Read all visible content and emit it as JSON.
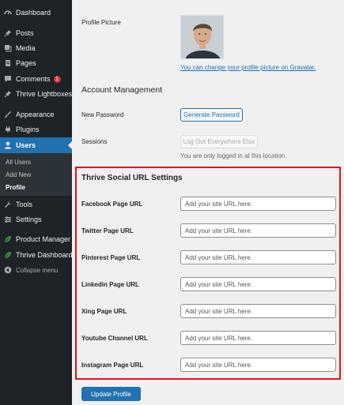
{
  "sidebar": {
    "items": [
      {
        "label": "Dashboard",
        "icon": "dashboard-icon"
      },
      {
        "label": "Posts",
        "icon": "pin-icon"
      },
      {
        "label": "Media",
        "icon": "media-icon"
      },
      {
        "label": "Pages",
        "icon": "page-icon"
      },
      {
        "label": "Comments",
        "icon": "comment-icon",
        "badge": "1"
      },
      {
        "label": "Thrive Lightboxes",
        "icon": "pin-icon"
      },
      {
        "label": "Appearance",
        "icon": "brush-icon"
      },
      {
        "label": "Plugins",
        "icon": "plugin-icon"
      },
      {
        "label": "Users",
        "icon": "user-icon"
      },
      {
        "label": "Tools",
        "icon": "wrench-icon"
      },
      {
        "label": "Settings",
        "icon": "settings-icon"
      },
      {
        "label": "Product Manager",
        "icon": "leaf-icon"
      },
      {
        "label": "Thrive Dashboard",
        "icon": "leaf-icon"
      },
      {
        "label": "Collapse menu",
        "icon": "collapse-icon"
      }
    ],
    "users_submenu": [
      "All Users",
      "Add New",
      "Profile"
    ]
  },
  "profile": {
    "picture_label": "Profile Picture",
    "gravatar_link": "You can change your profile picture on Gravatar",
    "gravatar_suffix": "."
  },
  "account": {
    "title": "Account Management",
    "new_password_label": "New Password",
    "generate_button": "Generate Password",
    "sessions_label": "Sessions",
    "logout_button": "Log Out Everywhere Else",
    "sessions_desc": "You are only logged in at this location."
  },
  "social": {
    "title": "Thrive Social URL Settings",
    "placeholder": "Add your site URL here.",
    "fields": [
      {
        "label": "Facebook Page URL"
      },
      {
        "label": "Twitter Page URL"
      },
      {
        "label": "Pinterest Page URL"
      },
      {
        "label": "Linkedin Page URL"
      },
      {
        "label": "Xing Page URL"
      },
      {
        "label": "Youtube Channel URL"
      },
      {
        "label": "Instagram Page URL"
      }
    ]
  },
  "update_button": "Update Profile",
  "colors": {
    "sidebar_bg": "#1d2327",
    "active_blue": "#2271b1",
    "highlight_red": "#e5131b",
    "badge_red": "#d63638"
  }
}
